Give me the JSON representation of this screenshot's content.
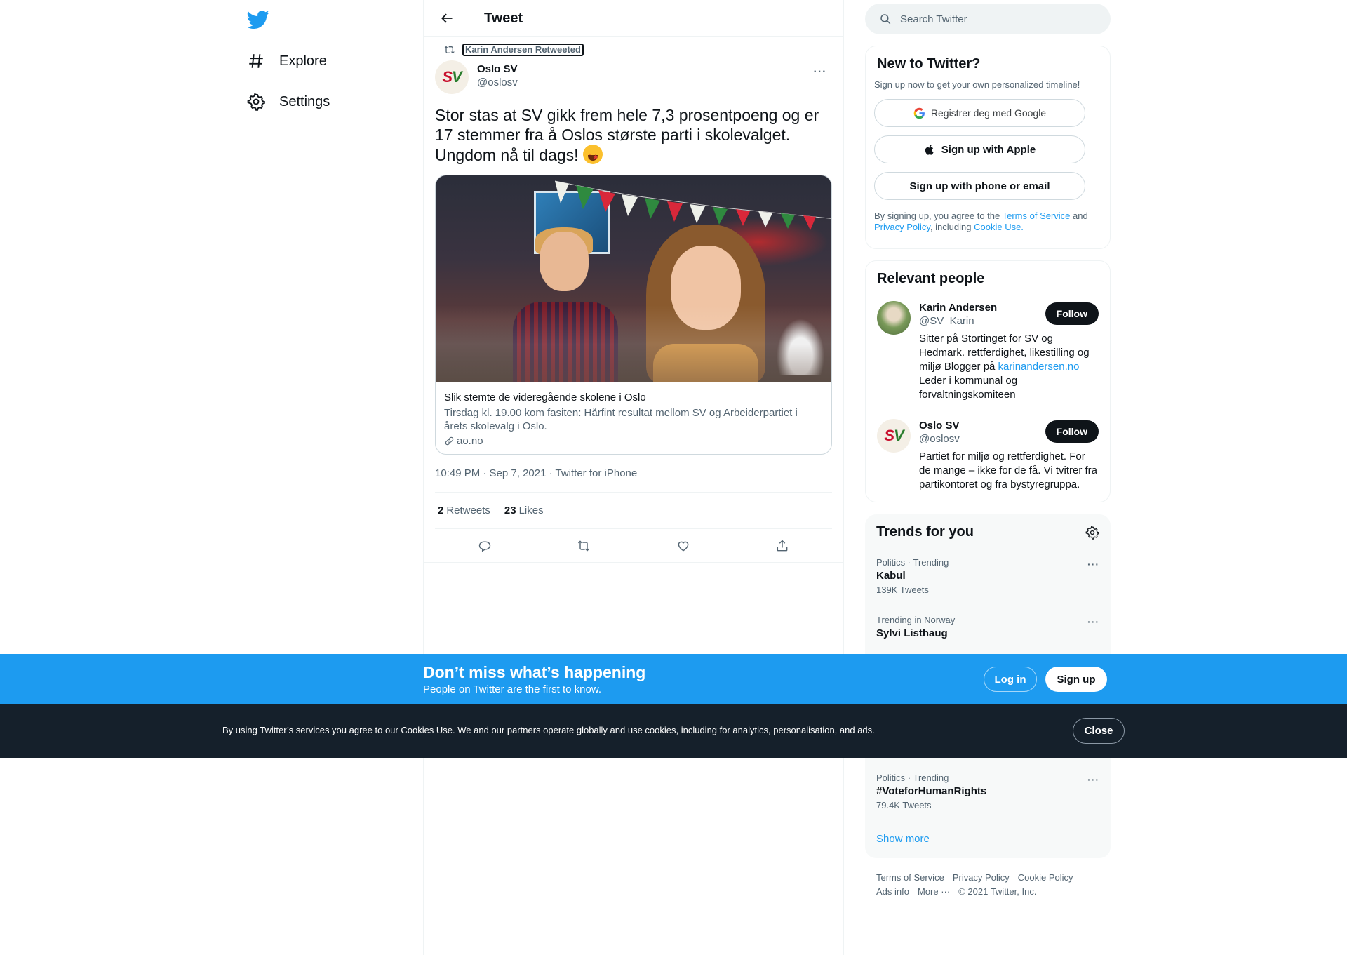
{
  "nav": {
    "logo": "twitter-bird-icon",
    "items": [
      {
        "label": "Explore",
        "icon": "hashtag-icon"
      },
      {
        "label": "Settings",
        "icon": "gear-icon"
      }
    ]
  },
  "header": {
    "title": "Tweet",
    "back_icon": "arrow-left-icon"
  },
  "tweet": {
    "retweeted_by": "Karin Andersen Retweeted",
    "author_name": "Oslo SV",
    "author_handle": "@oslosv",
    "text": "Stor stas at SV gikk frem hele 7,3 prosentpoeng og er 17 stemmer fra å Oslos største parti i skolevalget. Ungdom nå til dags!",
    "emoji": "star-struck",
    "card": {
      "title": "Slik stemte de videregående skolene i Oslo",
      "description": "Tirsdag kl. 19.00 kom fasiten: Hårfint resultat mellom SV og Arbeiderpartiet i årets skolevalg i Oslo.",
      "domain": "ao.no"
    },
    "meta": "10:49 PM · Sep 7, 2021 · Twitter for iPhone",
    "stats": {
      "retweets_count": "2",
      "retweets_label": "Retweets",
      "likes_count": "23",
      "likes_label": "Likes"
    }
  },
  "search": {
    "placeholder": "Search Twitter"
  },
  "new_to_twitter": {
    "title": "New to Twitter?",
    "subtitle": "Sign up now to get your own personalized timeline!",
    "google_label": "Registrer deg med Google",
    "apple_label": "Sign up with Apple",
    "phone_label": "Sign up with phone or email",
    "legal_prefix": "By signing up, you agree to the ",
    "terms_link": "Terms of Service",
    "legal_and": " and ",
    "privacy_link": "Privacy Policy",
    "legal_including": ", including ",
    "cookie_link": "Cookie Use."
  },
  "relevant_people": {
    "title": "Relevant people",
    "people": [
      {
        "name": "Karin Andersen",
        "handle": "@SV_Karin",
        "follow_label": "Follow",
        "bio_pre": "Sitter på Stortinget for SV og Hedmark. rettferdighet, likestilling og miljø Blogger på ",
        "bio_link": "karinandersen.no",
        "bio_post": " Leder i kommunal og forvaltningskomiteen"
      },
      {
        "name": "Oslo SV",
        "handle": "@oslosv",
        "follow_label": "Follow",
        "bio": "Partiet for miljø og rettferdighet. For de mange – ikke for de få. Vi tvitrer fra partikontoret og fra bystyregruppa."
      }
    ]
  },
  "trends": {
    "title": "Trends for you",
    "items": [
      {
        "meta": "Politics · Trending",
        "name": "Kabul",
        "count": "139K Tweets"
      },
      {
        "meta": "Trending in Norway",
        "name": "Sylvi Listhaug",
        "count": ""
      },
      {
        "meta": "Politics · Trending",
        "name": "#VoteforHumanRights",
        "count": "79.4K Tweets"
      }
    ],
    "show_more": "Show more"
  },
  "footer": {
    "links": [
      "Terms of Service",
      "Privacy Policy",
      "Cookie Policy",
      "Ads info",
      "More ···",
      "© 2021 Twitter, Inc."
    ]
  },
  "signup_bar": {
    "title": "Don’t miss what’s happening",
    "subtitle": "People on Twitter are the first to know.",
    "login": "Log in",
    "signup": "Sign up"
  },
  "cookie_bar": {
    "text": "By using Twitter’s services you agree to our Cookies Use. We and our partners operate globally and use cookies, including for analytics, personalisation, and ads.",
    "close": "Close"
  },
  "colors": {
    "brand_blue": "#1d9bf0",
    "text_primary": "#0f1419",
    "text_secondary": "#536471",
    "cookie_bg": "#15202b"
  }
}
